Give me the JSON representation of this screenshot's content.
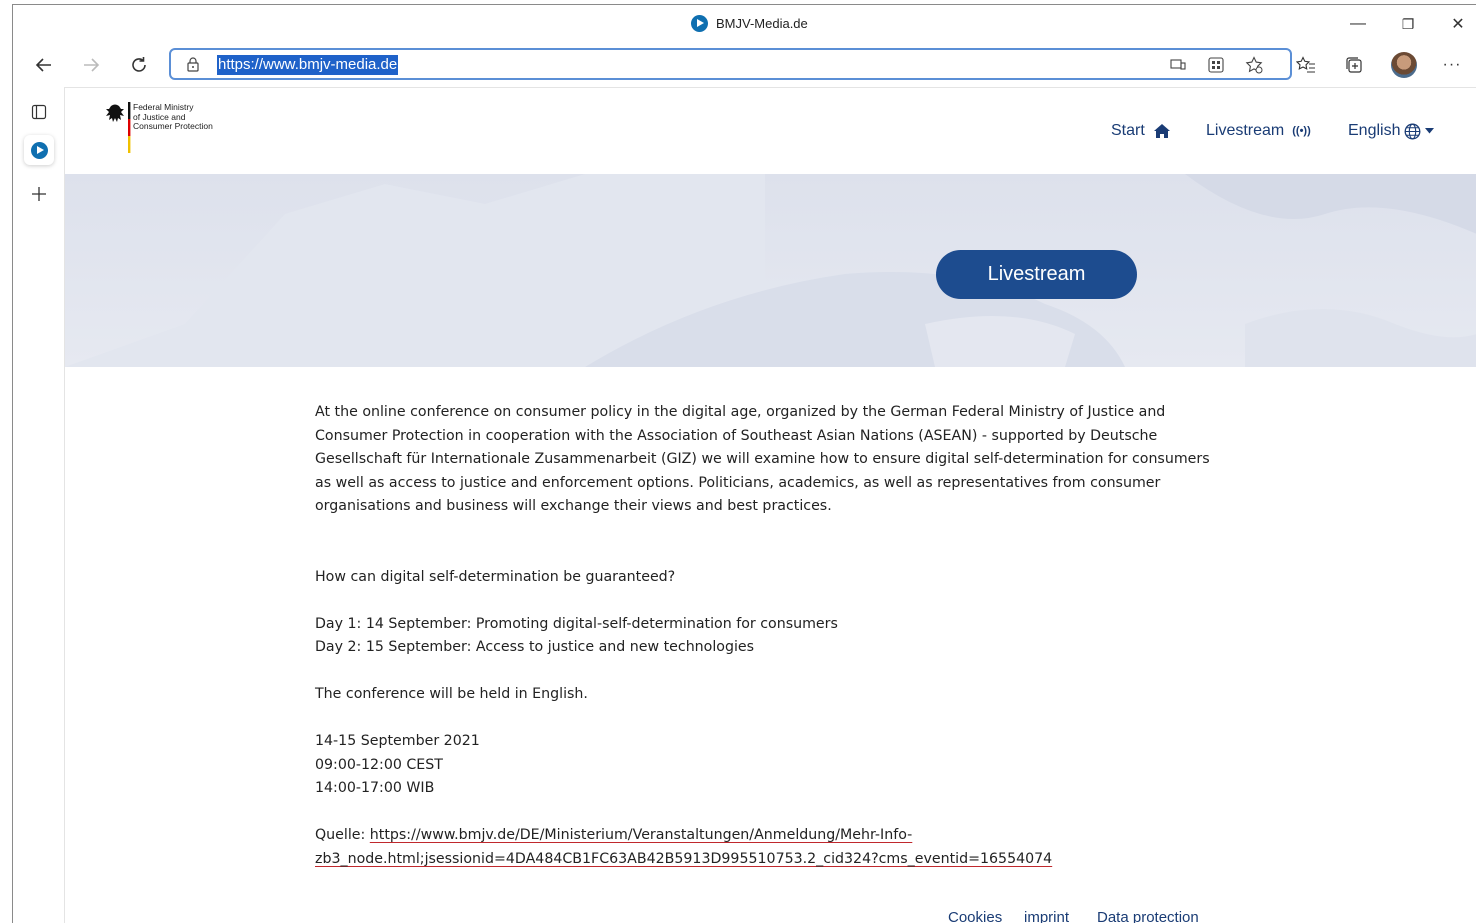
{
  "window": {
    "title": "BMJV-Media.de",
    "controls": {
      "minimize": "—",
      "restore": "❐",
      "close": "✕"
    }
  },
  "toolbar": {
    "url": "https://www.bmjv-media.de",
    "menu": "···"
  },
  "site": {
    "logo_lines": [
      "Federal Ministry",
      "of Justice and",
      "Consumer Protection"
    ],
    "nav": {
      "start": "Start",
      "livestream": "Livestream",
      "livestream_icon": "((•))",
      "language": "English"
    },
    "hero_button": "Livestream"
  },
  "content": {
    "intro": "At the online conference on consumer policy in the digital age, organized by the German Federal Ministry of Justice and Consumer Protection in cooperation with the Association of Southeast Asian Nations (ASEAN) - supported by Deutsche Gesellschaft für Internationale Zusammenarbeit (GIZ) we will examine how to ensure digital self-determination for consumers as well as access to justice and enforcement options. Politicians, academics, as well as representatives from consumer organisations and business will exchange their views and best practices.",
    "question": "How can digital self-determination be guaranteed?",
    "day1": "Day 1: 14 September: Promoting digital-self-determination for consumers",
    "day2": "Day 2: 15 September: Access to justice and new technologies",
    "language_note": "The conference will be held in English.",
    "dates": "14-15 September 2021",
    "time_cest": "09:00-12:00 CEST",
    "time_wib": "14:00-17:00 WIB",
    "source_label": "Quelle:",
    "source_url_line1": "https://www.bmjv.de/DE/Ministerium/Veranstaltungen/Anmeldung/Mehr-Info-",
    "source_url_line2": "zb3_node.html;jsessionid=4DA484CB1FC63AB42B5913D995510753.2_cid324?cms_eventid=16554074"
  },
  "footer": {
    "cookies": "Cookies",
    "imprint": "imprint",
    "data_protection": "Data protection"
  },
  "colors": {
    "brand_blue": "#1d4c8f",
    "nav_text": "#1a3c75",
    "url_highlight": "#1f62c9",
    "link_underline": "#c0282d"
  }
}
